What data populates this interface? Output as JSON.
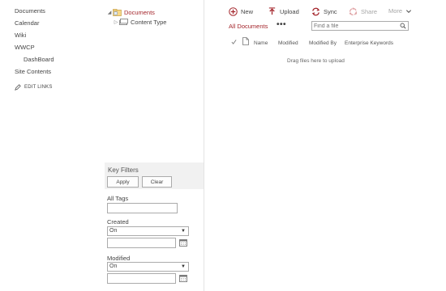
{
  "quicklaunch": {
    "items": [
      {
        "label": "Documents"
      },
      {
        "label": "Calendar"
      },
      {
        "label": "Wiki"
      },
      {
        "label": "WWCP"
      },
      {
        "label": "DashBoard"
      },
      {
        "label": "Site Contents"
      }
    ],
    "edit_links": "EDIT LINKS"
  },
  "tree": {
    "root": "Documents",
    "child": "Content Type"
  },
  "key_filters": {
    "title": "Key Filters",
    "apply_label": "Apply",
    "clear_label": "Clear",
    "all_tags_label": "All Tags",
    "all_tags_value": "",
    "created_label": "Created",
    "created_operator": "On",
    "created_value": "",
    "modified_label": "Modified",
    "modified_operator": "On",
    "modified_value": ""
  },
  "commands": {
    "new": "New",
    "upload": "Upload",
    "sync": "Sync",
    "share": "Share",
    "more": "More"
  },
  "view": {
    "current": "All Documents",
    "ellipsis": "•••",
    "search_placeholder": "Find a file"
  },
  "columns": [
    "Name",
    "Modified",
    "Modified By",
    "Enterprise Keywords"
  ],
  "dropzone": "Drag files here to upload",
  "colors": {
    "accent": "#a4262c",
    "text": "#444444",
    "panel": "#f1f1f1",
    "border": "#ababab"
  }
}
